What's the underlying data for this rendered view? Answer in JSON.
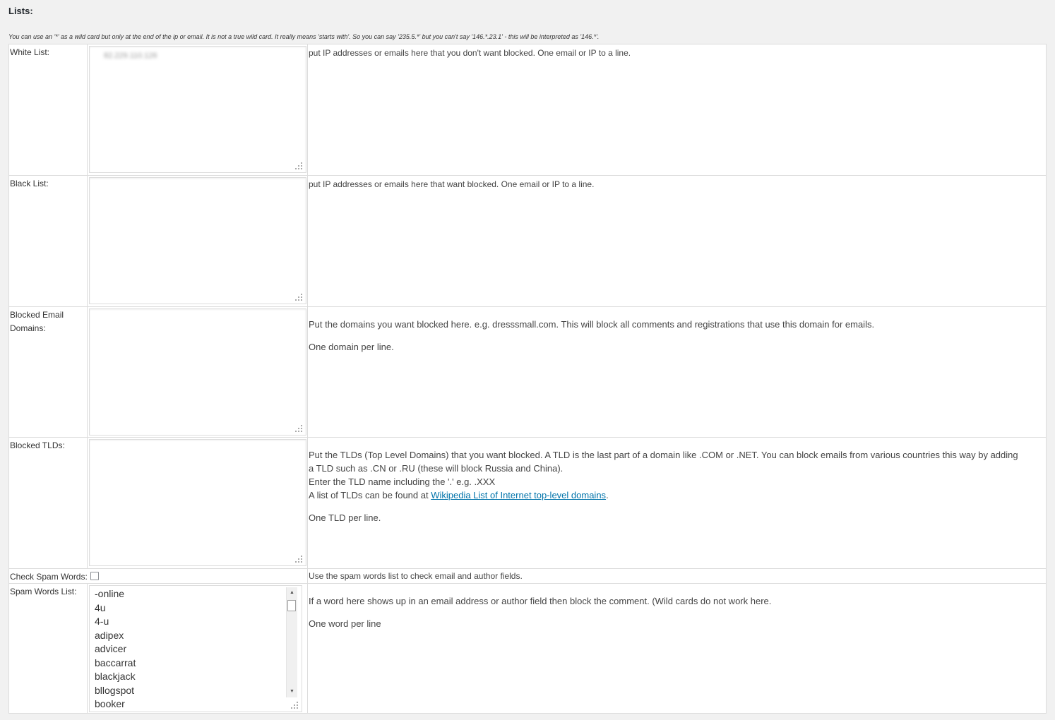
{
  "page": {
    "section_title": "Lists:",
    "wildcard_note": "You can use an '*' as a wild card but only at the end of the ip or email. It is not a true wild card. It really means 'starts with'. So you can say '235.5.*' but you can't say '146.*.23.1' - this will be interpreted as '146.*'."
  },
  "white_list": {
    "label": "White List:",
    "value": "82.229.110.126",
    "description": "put IP addresses or emails here that you don't want blocked. One email or IP to a line."
  },
  "black_list": {
    "label": "Black List:",
    "value": "",
    "description": "put IP addresses or emails here that want blocked. One email or IP to a line."
  },
  "blocked_email_domains": {
    "label": "Blocked Email Domains:",
    "value": "",
    "description": "Put the domains you want blocked here. e.g. dresssmall.com. This will block all comments and registrations that use this domain for emails.",
    "note": "One domain per line."
  },
  "blocked_tlds": {
    "label": "Blocked TLDs:",
    "value": "",
    "description": "Put the TLDs (Top Level Domains) that you want blocked. A TLD is the last part of a domain like .COM or .NET. You can block emails from various countries this way by adding a TLD such as .CN or .RU (these will block Russia and China).",
    "example": "Enter the TLD name including the '.' e.g. .XXX",
    "link_prefix": "A list of TLDs can be found at ",
    "link_text": "Wikipedia List of Internet top-level domains",
    "link_suffix": ".",
    "note": "One TLD per line."
  },
  "check_spam_words": {
    "label": "Check Spam Words:",
    "checked": false,
    "description": "Use the spam words list to check email and author fields."
  },
  "spam_words_list": {
    "label": "Spam Words List:",
    "items": [
      "-online",
      "4u",
      "4-u",
      "adipex",
      "advicer",
      "baccarrat",
      "blackjack",
      "bllogspot",
      "booker"
    ],
    "description": "If a word here shows up in an email address or author field then block the comment. (Wild cards do not work here.",
    "note": "One word per line"
  },
  "icons": {
    "resize_grip": "resize-grip-icon",
    "scroll_up": "scroll-up-arrow-icon",
    "scroll_down": "scroll-down-arrow-icon"
  },
  "colors": {
    "background": "#f1f1f1",
    "link": "#0073aa",
    "border": "#dcdcdc"
  }
}
